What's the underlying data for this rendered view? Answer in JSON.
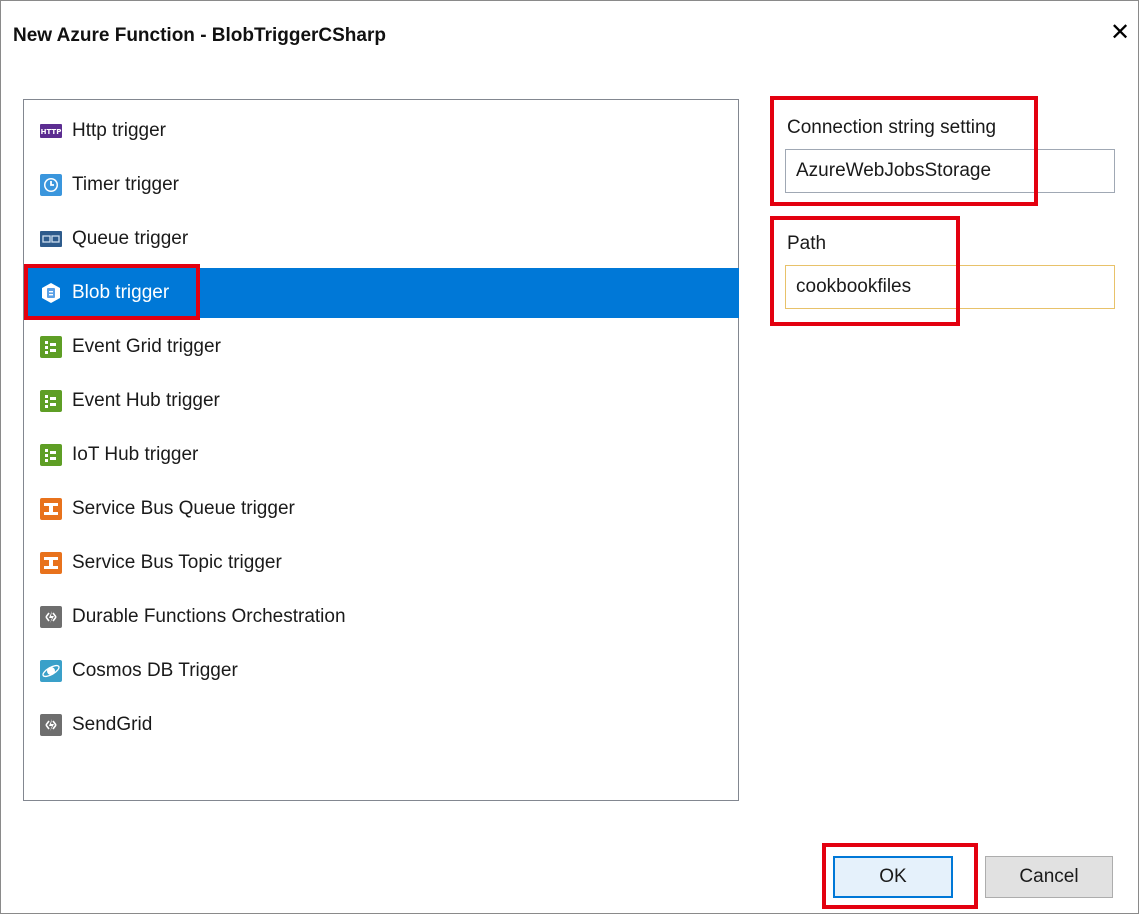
{
  "dialog": {
    "title": "New Azure Function - BlobTriggerCSharp",
    "close_glyph": "✕"
  },
  "templates": {
    "selected_index": 3,
    "items": [
      {
        "label": "Http trigger",
        "icon": "http-icon"
      },
      {
        "label": "Timer trigger",
        "icon": "timer-icon"
      },
      {
        "label": "Queue trigger",
        "icon": "queue-icon"
      },
      {
        "label": "Blob trigger",
        "icon": "blob-icon"
      },
      {
        "label": "Event Grid trigger",
        "icon": "event-grid-icon"
      },
      {
        "label": "Event Hub trigger",
        "icon": "event-hub-icon"
      },
      {
        "label": "IoT Hub trigger",
        "icon": "iot-hub-icon"
      },
      {
        "label": "Service Bus Queue trigger",
        "icon": "service-bus-queue-icon"
      },
      {
        "label": "Service Bus Topic trigger",
        "icon": "service-bus-topic-icon"
      },
      {
        "label": "Durable Functions Orchestration",
        "icon": "durable-functions-icon"
      },
      {
        "label": "Cosmos DB Trigger",
        "icon": "cosmos-db-icon"
      },
      {
        "label": "SendGrid",
        "icon": "sendgrid-icon"
      }
    ]
  },
  "settings": {
    "connection_label": "Connection string setting",
    "connection_value": "AzureWebJobsStorage",
    "path_label": "Path",
    "path_value": "cookbookfiles"
  },
  "buttons": {
    "ok": "OK",
    "cancel": "Cancel"
  },
  "colors": {
    "selection": "#0078d7",
    "highlight": "#e3000f",
    "focus_border": "#e8c26a"
  }
}
